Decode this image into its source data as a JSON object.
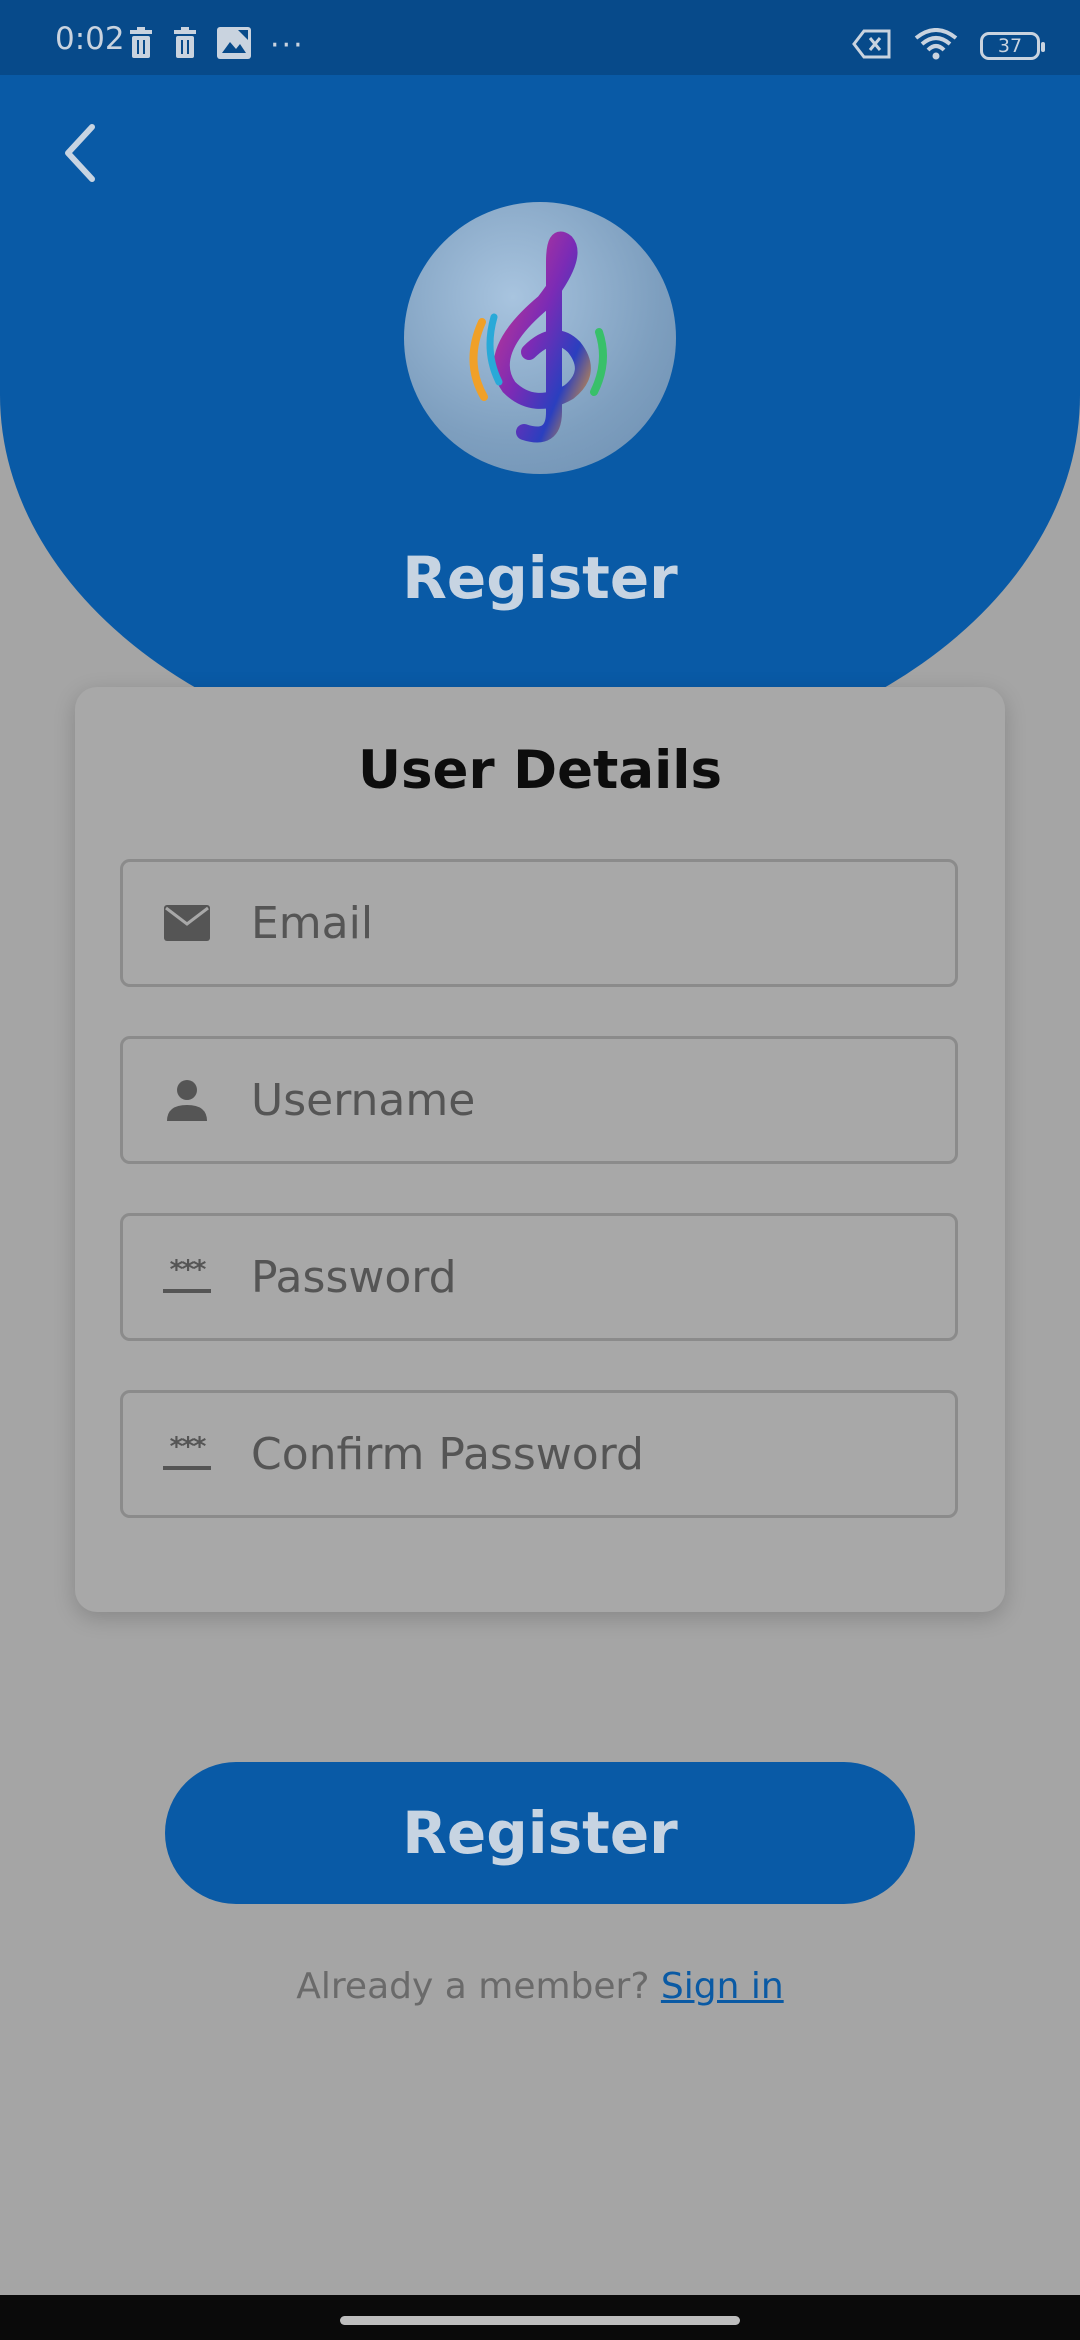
{
  "status_bar": {
    "time": "0:02",
    "battery": "37",
    "more": "···"
  },
  "header": {
    "title": "Register"
  },
  "form": {
    "title": "User Details",
    "fields": [
      {
        "placeholder": "Email",
        "icon": "mail-icon"
      },
      {
        "placeholder": "Username",
        "icon": "person-icon"
      },
      {
        "placeholder": "Password",
        "icon": "password-icon"
      },
      {
        "placeholder": "Confirm Password",
        "icon": "password-icon"
      }
    ],
    "password_icon_glyph": "***"
  },
  "actions": {
    "register_label": "Register",
    "member_text": "Already a member? ",
    "signin_label": "Sign in"
  },
  "colors": {
    "primary": "#095aa6",
    "status_bar": "#074a8a",
    "dimmed_background": "#a5a5a5"
  }
}
